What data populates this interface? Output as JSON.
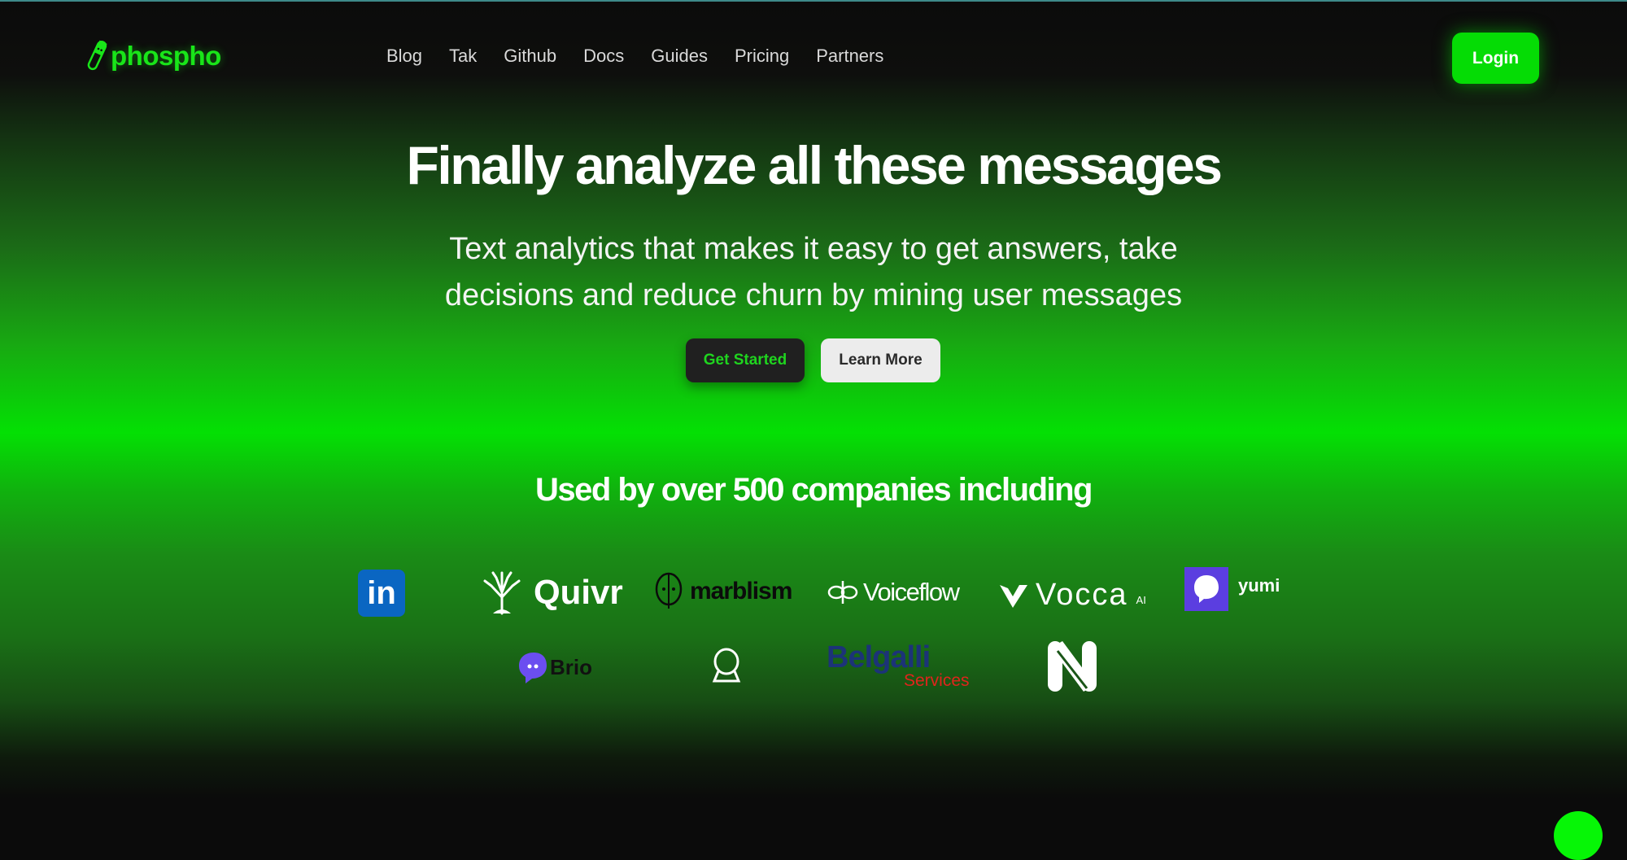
{
  "header": {
    "brand": "phospho",
    "nav": [
      "Blog",
      "Tak",
      "Github",
      "Docs",
      "Guides",
      "Pricing",
      "Partners"
    ],
    "login_label": "Login"
  },
  "hero": {
    "title": "Finally analyze all these messages",
    "subtitle": "Text analytics that makes it easy to get answers, take decisions and reduce churn by mining user messages",
    "get_started_label": "Get Started",
    "learn_more_label": "Learn More"
  },
  "customers": {
    "heading": "Used by over 500 companies including",
    "logos": {
      "linkedin": "in",
      "quivr": "Quivr",
      "marblism": "marblism",
      "voiceflow": "Voiceflow",
      "vocca": "Vocca",
      "vocca_suffix": "AI",
      "yumi": "yumi",
      "brio": "Brio",
      "belgalli": "Belgalli",
      "belgalli_sub": "Services"
    }
  },
  "colors": {
    "brand_green": "#05dc05",
    "background": "#0b0b0b"
  }
}
